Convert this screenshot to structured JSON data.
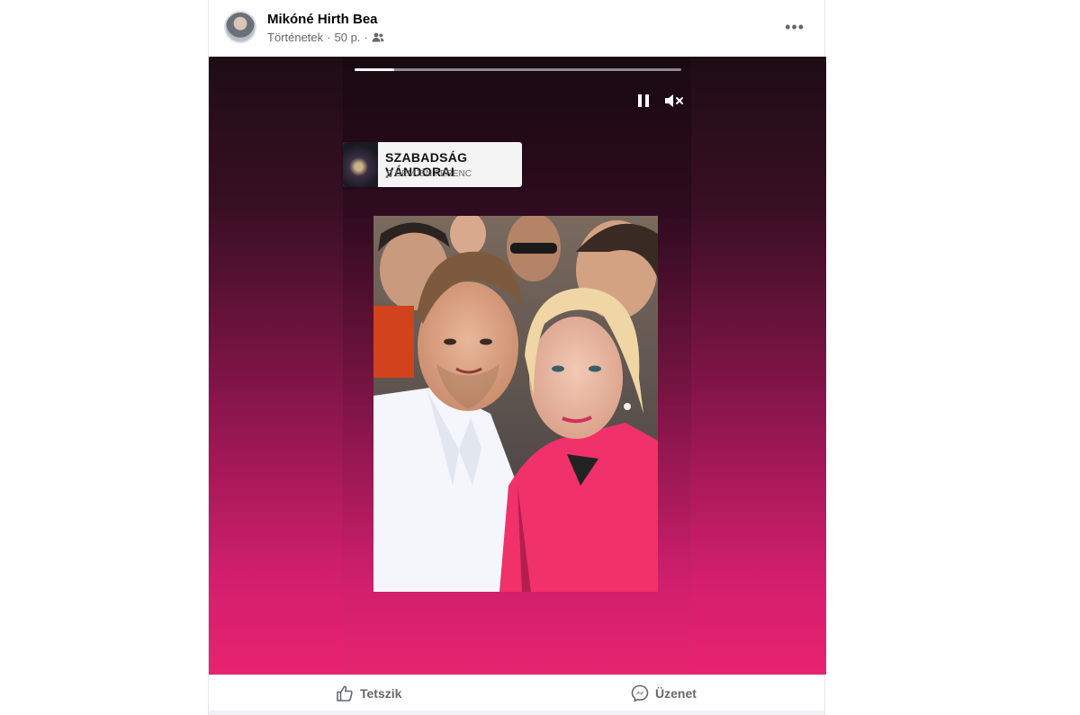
{
  "post": {
    "author": "Mikóné Hirth Bea",
    "source": "Történetek",
    "time": "50 p.",
    "audience_icon": "friends-icon",
    "more_label": "•••"
  },
  "story": {
    "progress_percent": 12,
    "controls": {
      "pause_icon": "pause-icon",
      "mute_icon": "speaker-muted-icon"
    },
    "music": {
      "title": "SZABADSÁG VÁNDORAI",
      "artist": "DEMJÉN FERENC",
      "note_icon": "music-note-icon"
    }
  },
  "actions": {
    "like_label": "Tetszik",
    "message_label": "Üzenet"
  },
  "colors": {
    "accent_pink": "#e8226f",
    "dark_top": "#1d0d14",
    "text_secondary": "#65676b"
  }
}
